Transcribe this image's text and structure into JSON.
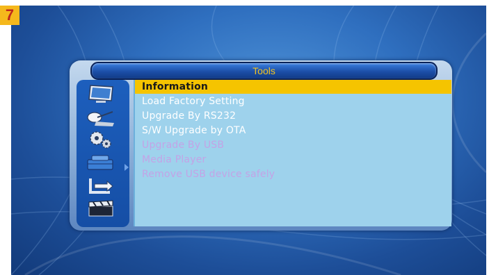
{
  "badge": "7",
  "dialog": {
    "title": "Tools",
    "items": [
      {
        "label": "Information",
        "state": "selected"
      },
      {
        "label": "Load Factory Setting",
        "state": "enabled"
      },
      {
        "label": "Upgrade By RS232",
        "state": "enabled"
      },
      {
        "label": "S/W Upgrade by OTA",
        "state": "enabled"
      },
      {
        "label": "Upgrade By USB",
        "state": "disabled"
      },
      {
        "label": "Media Player",
        "state": "disabled"
      },
      {
        "label": "Remove USB device safely",
        "state": "disabled"
      }
    ],
    "side_icons": [
      "monitor-icon",
      "satellite-dish-icon",
      "gears-icon",
      "toolbox-icon",
      "stairs-arrow-icon",
      "clapperboard-icon"
    ],
    "active_side_icon": "toolbox-icon"
  },
  "colors": {
    "highlight": "#f5c400",
    "title_text": "#f2c321",
    "enabled_text": "#ffffff",
    "disabled_text": "#c3a3e6",
    "list_background": "#9ed2ec",
    "badge_background": "#f5b81c",
    "badge_text": "#c0281c"
  }
}
